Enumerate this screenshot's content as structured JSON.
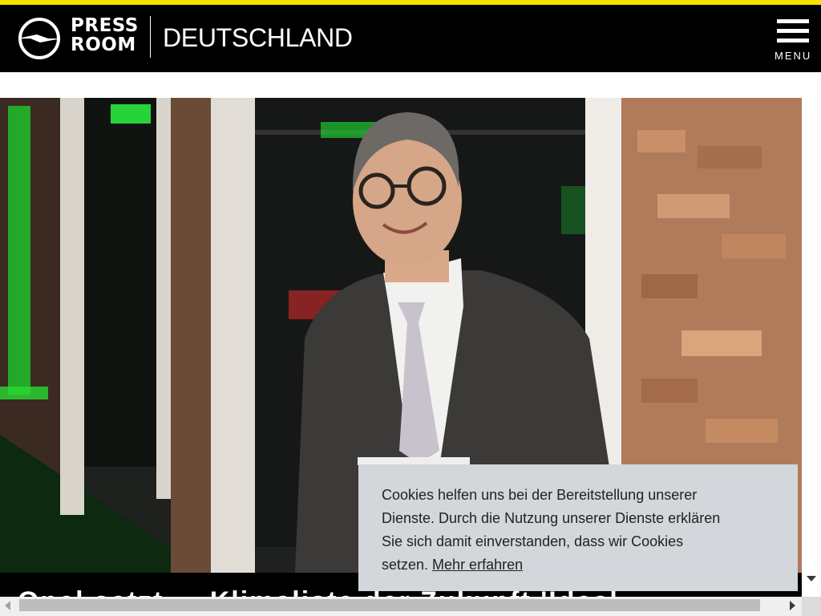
{
  "header": {
    "logo_line1": "PRESS",
    "logo_line2": "ROOM",
    "region": "DEUTSCHLAND",
    "menu_label": "MENU"
  },
  "hero": {
    "headline": "Opel setzt ... Klimaliste der Zukunft 'Ideal"
  },
  "cookie_banner": {
    "line1": "Cookies helfen uns bei der Bereitstellung unserer",
    "line2": "Dienste. Durch die Nutzung unserer Dienste erklären",
    "line3": "Sie sich damit einverstanden, dass wir Cookies",
    "line4_prefix": "setzen. ",
    "link": "Mehr erfahren"
  },
  "colors": {
    "accent": "#f7e100",
    "header_bg": "#000000",
    "banner_bg": "#d3d6db"
  },
  "icons": [
    "opel-blitz-icon",
    "hamburger-menu-icon",
    "scroll-arrow-icon"
  ]
}
